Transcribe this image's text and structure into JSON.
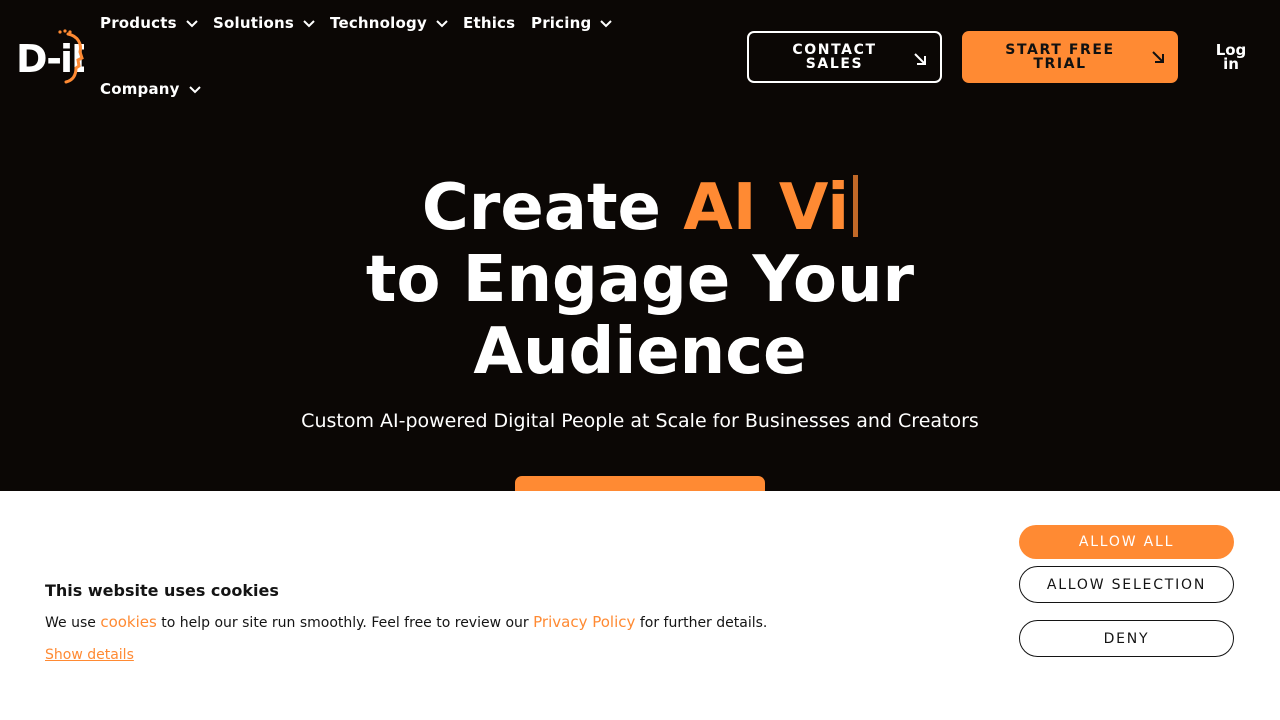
{
  "brand": {
    "logo_text": "D-ID",
    "accent_color": "#ff8a33",
    "background_color": "#0b0705"
  },
  "nav": {
    "items": [
      {
        "label": "Products",
        "has_dropdown": true,
        "icon": "chevron-down-icon"
      },
      {
        "label": "Solutions",
        "has_dropdown": true,
        "icon": "chevron-down-icon"
      },
      {
        "label": "Technology",
        "has_dropdown": true,
        "icon": "chevron-down-icon"
      },
      {
        "label": "Ethics",
        "has_dropdown": false
      },
      {
        "label": "Pricing",
        "has_dropdown": true,
        "icon": "chevron-down-icon"
      },
      {
        "label": "Company",
        "has_dropdown": true,
        "icon": "chevron-down-icon"
      }
    ],
    "contact_sales_label": "CONTACT SALES",
    "start_free_trial_label": "START FREE TRIAL",
    "arrow_icon": "arrow-down-right-icon",
    "login_label": "Log in"
  },
  "hero": {
    "title_prefix": "Create ",
    "title_typed": "AI Vi",
    "title_line2": "to Engage Your",
    "title_line3": "Audience",
    "subtitle": "Custom AI-powered Digital People at Scale for Businesses and Creators"
  },
  "cookie_banner": {
    "title": "This website uses cookies",
    "text_before": "We use ",
    "cookies_link": "cookies",
    "text_middle": " to help our site run smoothly. Feel free to review our ",
    "privacy_link": "Privacy Policy",
    "text_after": " for further details.",
    "show_details_label": "Show details",
    "allow_all_label": "ALLOW ALL",
    "allow_selection_label": "ALLOW SELECTION",
    "deny_label": "DENY"
  }
}
